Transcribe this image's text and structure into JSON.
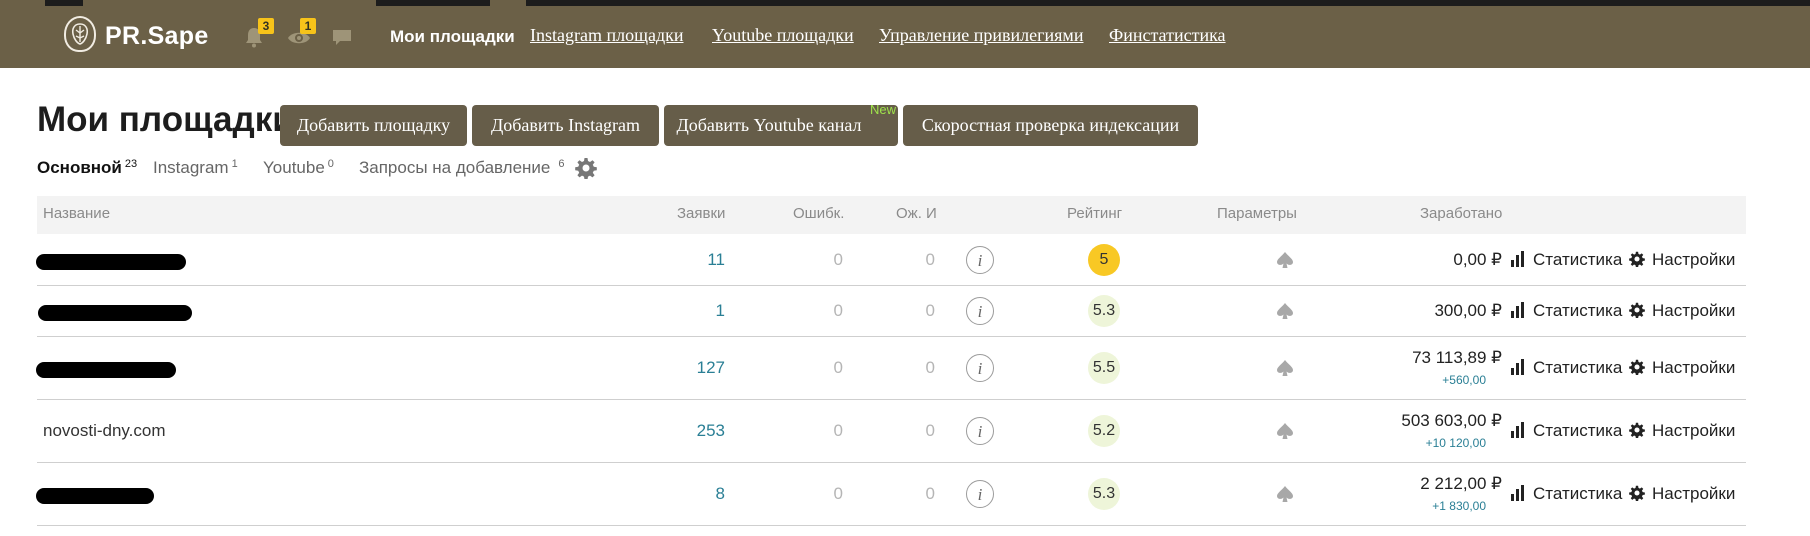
{
  "header": {
    "brand": "PR.Sape",
    "notifications_count": "3",
    "views_count": "1",
    "nav": [
      {
        "label": "Мои площадки",
        "active": true
      },
      {
        "label": "Instagram площадки"
      },
      {
        "label": "Youtube площадки"
      },
      {
        "label": "Управление привилегиями"
      },
      {
        "label": "Финстатистика"
      }
    ],
    "bar_color": "#6b6047"
  },
  "page": {
    "title": "Мои площадки",
    "buttons": [
      {
        "label": "Добавить площадку"
      },
      {
        "label": "Добавить Instagram"
      },
      {
        "label": "Добавить Youtube канал",
        "tag": "New"
      },
      {
        "label": "Скоростная проверка индексации"
      }
    ],
    "tabs": [
      {
        "label": "Основной",
        "count": "23",
        "active": true
      },
      {
        "label": "Instagram",
        "count": "1"
      },
      {
        "label": "Youtube",
        "count": "0"
      },
      {
        "label": "Запросы на добавление",
        "count": "6"
      }
    ]
  },
  "table": {
    "columns": [
      "Название",
      "Заявки",
      "Ошибк.",
      "Ож. И",
      "Рейтинг",
      "Параметры",
      "Заработано"
    ],
    "rows": [
      {
        "name": "",
        "name_redacted": true,
        "requests": "11",
        "errors": "0",
        "waiting": "0",
        "rating": "5",
        "rating_style": "yellow",
        "earned": "0,00 ₽",
        "delta": "",
        "stats": "Статистика",
        "settings": "Настройки"
      },
      {
        "name": "",
        "name_redacted": true,
        "requests": "1",
        "errors": "0",
        "waiting": "0",
        "rating": "5.3",
        "rating_style": "green",
        "earned": "300,00 ₽",
        "delta": "",
        "stats": "Статистика",
        "settings": "Настройки"
      },
      {
        "name": "",
        "name_redacted": true,
        "requests": "127",
        "errors": "0",
        "waiting": "0",
        "rating": "5.5",
        "rating_style": "green",
        "earned": "73 113,89 ₽",
        "delta": "+560,00",
        "stats": "Статистика",
        "settings": "Настройки"
      },
      {
        "name": "novosti-dny.com",
        "name_redacted": false,
        "requests": "253",
        "errors": "0",
        "waiting": "0",
        "rating": "5.2",
        "rating_style": "green",
        "earned": "503 603,00 ₽",
        "delta": "+10 120,00",
        "stats": "Статистика",
        "settings": "Настройки"
      },
      {
        "name": "",
        "name_redacted": true,
        "requests": "8",
        "errors": "0",
        "waiting": "0",
        "rating": "5.3",
        "rating_style": "green",
        "earned": "2 212,00 ₽",
        "delta": "+1 830,00",
        "stats": "Статистика",
        "settings": "Настройки"
      }
    ]
  }
}
